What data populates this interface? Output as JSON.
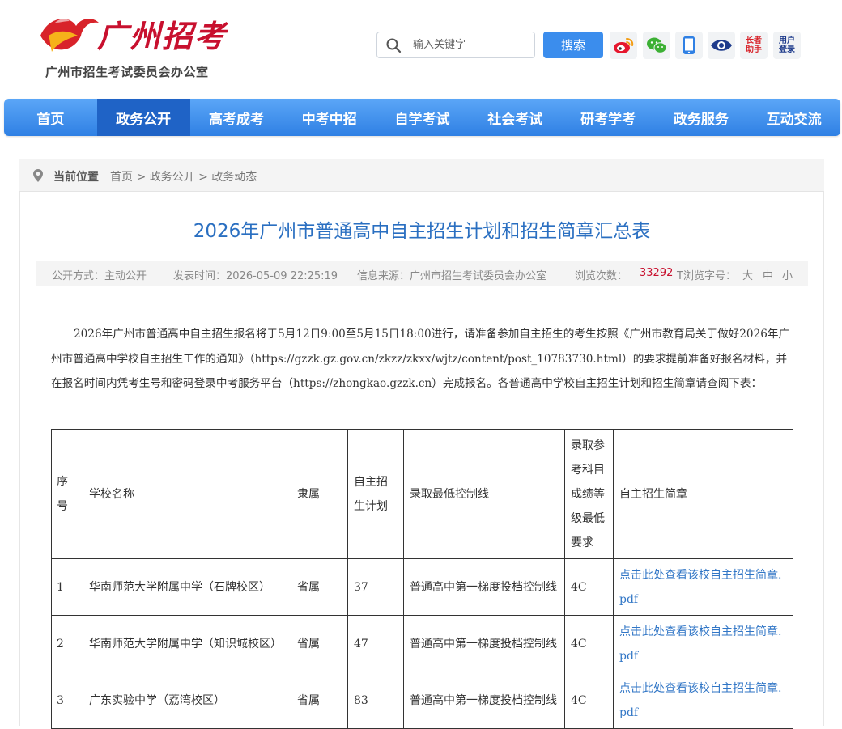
{
  "site": {
    "logo_text": "广州招考",
    "org_name": "广州市招生考试委员会办公室"
  },
  "search": {
    "placeholder": "输入关键字",
    "button": "搜索"
  },
  "social": {
    "elder_mode": "长者助手",
    "user_login": "用户登录"
  },
  "nav": {
    "items": [
      "首页",
      "政务公开",
      "高考成考",
      "中考中招",
      "自学考试",
      "社会考试",
      "研考学考",
      "政务服务",
      "互动交流"
    ],
    "active_index": 1
  },
  "breadcrumb": {
    "label": "当前位置",
    "items": [
      "首页",
      "政务公开",
      "政务动态"
    ],
    "separator": ">"
  },
  "article": {
    "title": "2026年广州市普通高中自主招生计划和招生简章汇总表",
    "meta": {
      "disclosure": "公开方式：主动公开",
      "published": "发表时间：2026-05-09 22:25:19",
      "source": "信息来源：广州市招生考试委员会办公室",
      "views_label": "浏览次数：",
      "views": "33292",
      "fontsize_label": "T浏览字号：",
      "font_large": "大",
      "font_medium": "中",
      "font_small": "小"
    },
    "intro": "2026年广州市普通高中自主招生报名将于5月12日9:00至5月15日18:00进行，请准备参加自主招生的考生按照《广州市教育局关于做好2026年广州市普通高中学校自主招生工作的通知》（https://gzzk.gz.gov.cn/zkzz/zkxx/wjtz/content/post_10783730.html）的要求提前准备好报名材料，并在报名时间内凭考生号和密码登录中考服务平台（https://zhongkao.gzzk.cn）完成报名。各普通高中学校自主招生计划和招生简章请查阅下表："
  },
  "table": {
    "headers": [
      "序号",
      "学校名称",
      "隶属",
      "自主招生计划",
      "录取最低控制线",
      "录取参考科目成绩等级最低要求",
      "自主招生简章"
    ],
    "rows": [
      [
        "1",
        "华南师范大学附属中学（石牌校区）",
        "省属",
        "37",
        "普通高中第一梯度投档控制线",
        "4C",
        "点击此处查看该校自主招生简章.pdf"
      ],
      [
        "2",
        "华南师范大学附属中学（知识城校区）",
        "省属",
        "47",
        "普通高中第一梯度投档控制线",
        "4C",
        "点击此处查看该校自主招生简章.pdf"
      ],
      [
        "3",
        "广东实验中学（荔湾校区）",
        "省属",
        "83",
        "普通高中第一梯度投档控制线",
        "4C",
        "点击此处查看该校自主招生简章.pdf"
      ]
    ]
  },
  "colors": {
    "nav_blue": "#3b8ded",
    "nav_active": "#1f63c6",
    "title_blue": "#2a6fc1",
    "views_red": "#c8102e",
    "link_blue": "#3176c6"
  },
  "icons": [
    "search-icon",
    "weibo-icon",
    "wechat-icon",
    "mobile-icon",
    "eye-icon",
    "location-pin-icon"
  ]
}
